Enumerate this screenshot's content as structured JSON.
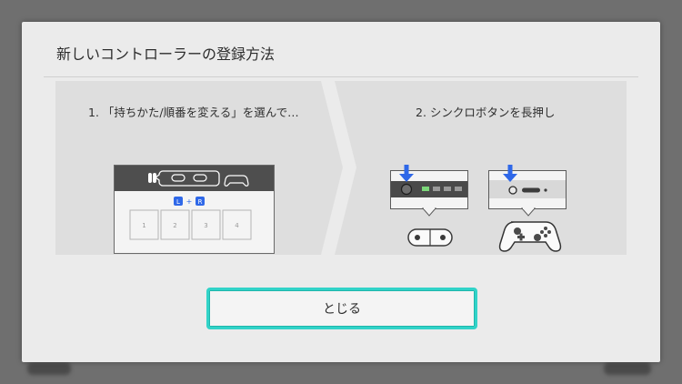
{
  "dialog": {
    "title": "新しいコントローラーの登録方法",
    "close_label": "とじる"
  },
  "steps": [
    {
      "label": "1. 「持ちかた/順番を変える」を選んで…"
    },
    {
      "label": "2. シンクロボタンを長押し"
    }
  ],
  "screen_mock": {
    "l_key": "L",
    "plus": "+",
    "r_key": "R",
    "slots": [
      "1",
      "2",
      "3",
      "4"
    ]
  },
  "colors": {
    "accent": "#31d3c8",
    "arrow": "#2f68e8",
    "panel": "#dedede",
    "dialog": "#ebebeb"
  }
}
